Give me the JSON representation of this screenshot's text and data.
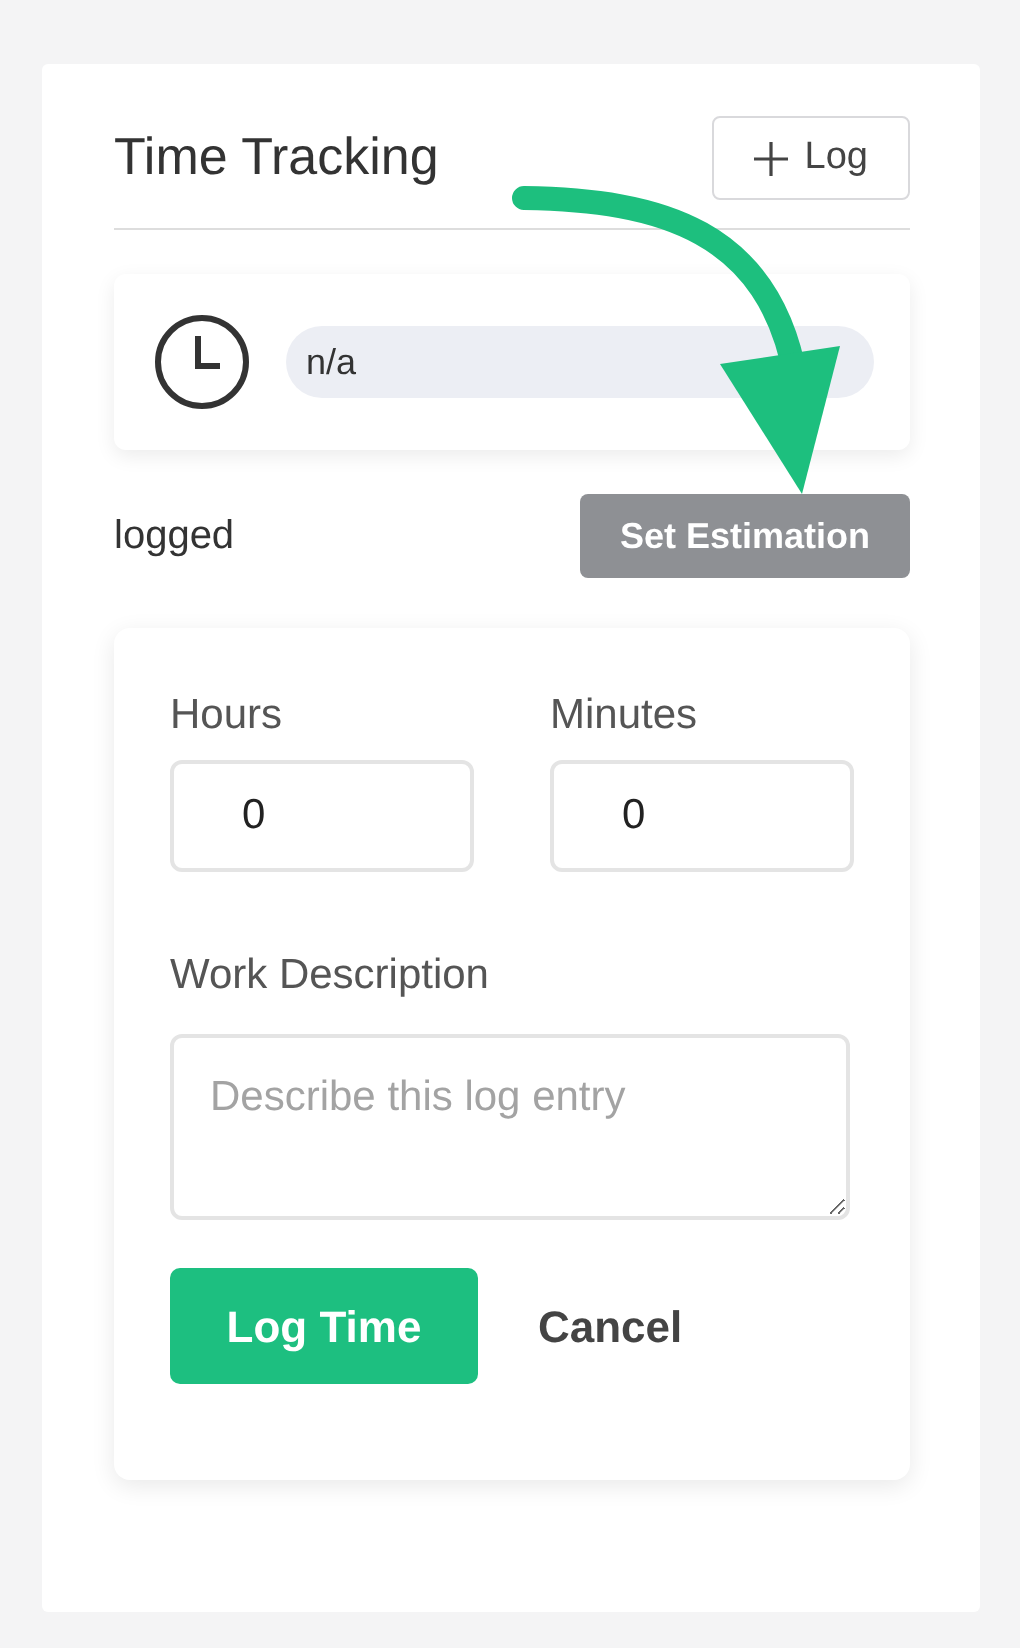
{
  "panel": {
    "title": "Time Tracking",
    "add_button": "Log"
  },
  "estimate": {
    "value": "n/a"
  },
  "logged_label": "logged",
  "set_estimation_button": "Set Estimation",
  "form": {
    "fields": [
      {
        "label": "Hours",
        "value": "0"
      },
      {
        "label": "Minutes",
        "value": "0"
      }
    ],
    "description": {
      "label": "Work Description",
      "placeholder": "Describe this log entry"
    },
    "submit_button": "Log Time",
    "cancel_button": "Cancel"
  }
}
